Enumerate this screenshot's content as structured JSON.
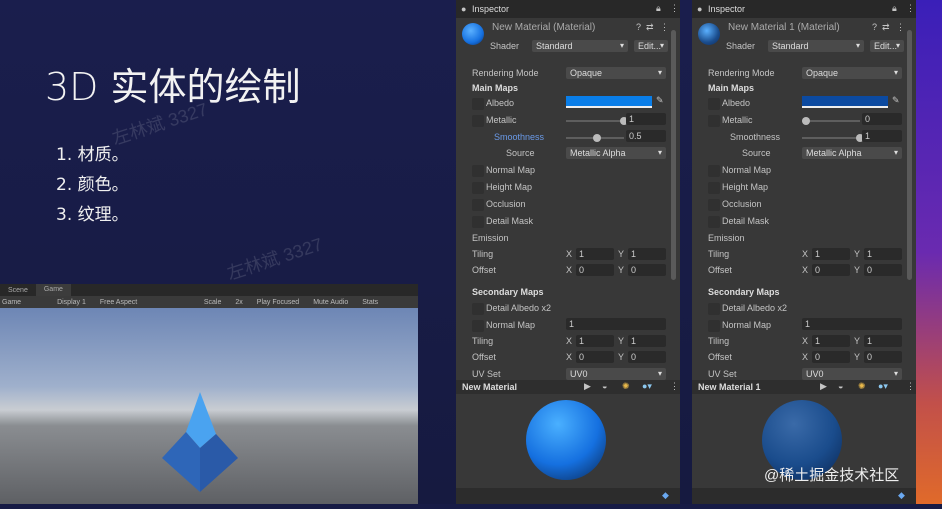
{
  "slide": {
    "title": "3D 实体的绘制",
    "items": [
      "1. 材质。",
      "2. 颜色。",
      "3. 纹理。"
    ],
    "watermark": "左林斌 3327",
    "credit": "@稀土掘金技术社区"
  },
  "game_view": {
    "tabs": [
      "Scene",
      "Game"
    ],
    "toolbar": [
      "Game",
      "Display 1",
      "Free Aspect",
      "Scale",
      "2x",
      "Play Focused",
      "Mute Audio",
      "Stats"
    ]
  },
  "labels": {
    "inspector": "Inspector",
    "shader": "Shader",
    "edit": "Edit...",
    "rendering_mode": "Rendering Mode",
    "main_maps": "Main Maps",
    "albedo": "Albedo",
    "metallic": "Metallic",
    "smoothness": "Smoothness",
    "source": "Source",
    "normal_map": "Normal Map",
    "height_map": "Height Map",
    "occlusion": "Occlusion",
    "detail_mask": "Detail Mask",
    "emission": "Emission",
    "tiling": "Tiling",
    "offset": "Offset",
    "secondary_maps": "Secondary Maps",
    "detail_albedo": "Detail Albedo x2",
    "uv_set": "UV Set",
    "x": "X",
    "y": "Y"
  },
  "panels": [
    {
      "material_title": "New Material (Material)",
      "preview_name": "New Material",
      "shader": "Standard",
      "rendering_mode": "Opaque",
      "albedo_color": "#0a7ee8",
      "metallic": 1,
      "metallic_text": "1",
      "smoothness": 0.5,
      "smoothness_text": "0.5",
      "source": "Metallic Alpha",
      "tiling": [
        "1",
        "1"
      ],
      "offset": [
        "0",
        "0"
      ],
      "normal_scale": "1",
      "tiling2": [
        "1",
        "1"
      ],
      "offset2": [
        "0",
        "0"
      ],
      "uv_set": "UV0",
      "sphere_color": "#1570e0"
    },
    {
      "material_title": "New Material 1 (Material)",
      "preview_name": "New Material 1",
      "shader": "Standard",
      "rendering_mode": "Opaque",
      "albedo_color": "#0c4aa0",
      "metallic": 0,
      "metallic_text": "0",
      "smoothness": 1,
      "smoothness_text": "1",
      "source": "Metallic Alpha",
      "tiling": [
        "1",
        "1"
      ],
      "offset": [
        "0",
        "0"
      ],
      "normal_scale": "1",
      "tiling2": [
        "1",
        "1"
      ],
      "offset2": [
        "0",
        "0"
      ],
      "uv_set": "UV0",
      "sphere_color": "#1a4c8c"
    }
  ]
}
